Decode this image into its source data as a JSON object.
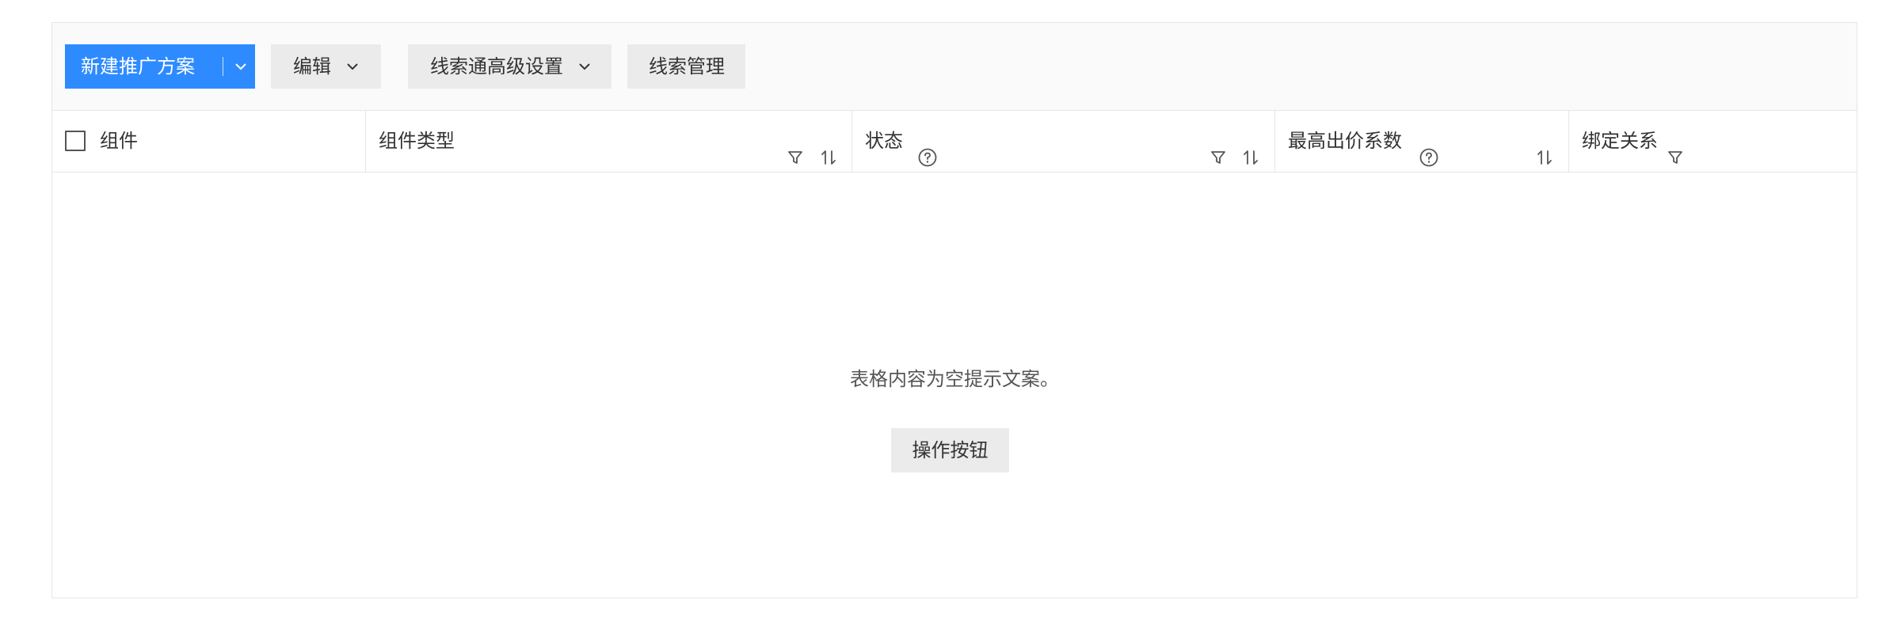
{
  "toolbar": {
    "new_plan_label": "新建推广方案",
    "edit_label": "编辑",
    "advanced_settings_label": "线索通高级设置",
    "clue_manage_label": "线索管理",
    "primary_color": "#2e8bff"
  },
  "table": {
    "columns": [
      {
        "label": "组件",
        "icons": [
          "checkbox"
        ]
      },
      {
        "label": "组件类型",
        "icons": [
          "filter-icon",
          "sort-icon"
        ]
      },
      {
        "label": "状态",
        "icons": [
          "help-icon",
          "filter-icon",
          "sort-icon"
        ]
      },
      {
        "label": "最高出价系数",
        "icons": [
          "help-icon",
          "sort-icon"
        ]
      },
      {
        "label": "绑定关系",
        "icons": [
          "filter-icon"
        ]
      }
    ],
    "empty_text": "表格内容为空提示文案。",
    "empty_action_label": "操作按钮"
  }
}
